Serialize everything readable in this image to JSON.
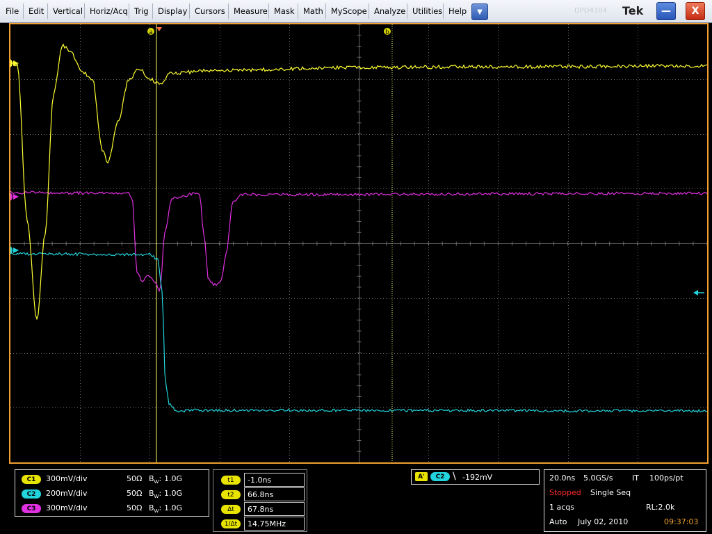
{
  "menu": {
    "items": [
      "File",
      "Edit",
      "Vertical",
      "Horiz/Acq",
      "Trig",
      "Display",
      "Cursors",
      "Measure",
      "Mask",
      "Math",
      "MyScope",
      "Analyze",
      "Utilities",
      "Help"
    ],
    "dropdown_glyph": "▼",
    "brand": "Tek",
    "ghost_text": "DPO4104",
    "minimize_glyph": "—",
    "close_glyph": "X"
  },
  "colors": {
    "ch1": "#ffff33",
    "ch2": "#22d4dc",
    "ch3": "#e030e0",
    "frame": "#f0a030",
    "cursor": "#ffff66"
  },
  "scope": {
    "ch_markers": [
      "1",
      "3",
      "2"
    ],
    "cursor_a_label": "a",
    "cursor_b_label": "b"
  },
  "channels": [
    {
      "badge": "C1",
      "scale": "300mV/div",
      "imp": "50Ω",
      "bw": "1.0G"
    },
    {
      "badge": "C2",
      "scale": "200mV/div",
      "imp": "50Ω",
      "bw": "1.0G"
    },
    {
      "badge": "C3",
      "scale": "300mV/div",
      "imp": "50Ω",
      "bw": "1.0G"
    }
  ],
  "bw_prefix": "B",
  "bw_sub": "W",
  "bw_colon": ":",
  "cursors": [
    {
      "label": "t1",
      "value": "-1.0ns"
    },
    {
      "label": "t2",
      "value": "66.8ns"
    },
    {
      "label": "Δt",
      "value": "67.8ns"
    },
    {
      "label": "1/Δt",
      "value": "14.75MHz"
    }
  ],
  "trigger": {
    "source_badge": "A'",
    "channel_badge": "C2",
    "slope_glyph": "\\",
    "level": "-192mV"
  },
  "acq": {
    "timebase": "20.0ns",
    "sample_rate": "5.0GS/s",
    "mode": "IT",
    "resolution": "100ps/pt",
    "status": "Stopped",
    "seq": "Single Seq",
    "acqs": "1 acqs",
    "record_length": "RL:2.0k",
    "trigger_mode": "Auto",
    "date": "July 02, 2010",
    "time": "09:37:03"
  }
}
